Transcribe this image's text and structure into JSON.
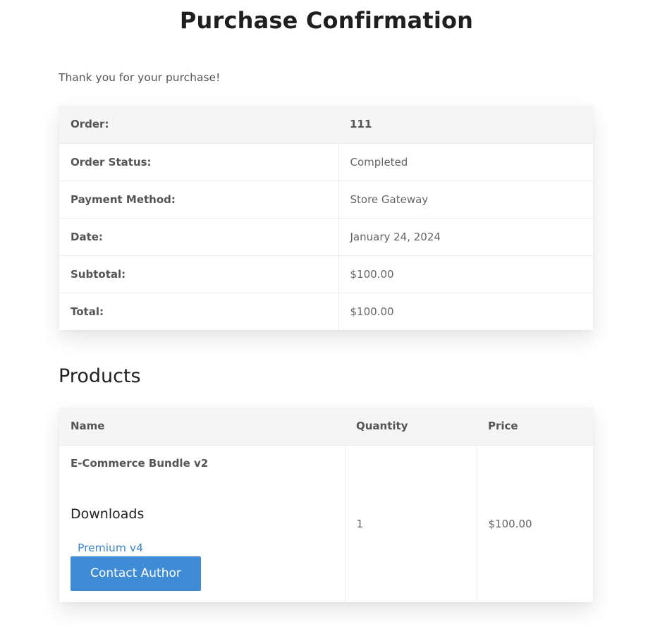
{
  "page": {
    "title": "Purchase Confirmation",
    "intro": "Thank you for your purchase!"
  },
  "order": {
    "rows": [
      {
        "label": "Order:",
        "value": "111"
      },
      {
        "label": "Order Status:",
        "value": "Completed"
      },
      {
        "label": "Payment Method:",
        "value": "Store Gateway"
      },
      {
        "label": "Date:",
        "value": "January 24, 2024"
      },
      {
        "label": "Subtotal:",
        "value": "$100.00"
      },
      {
        "label": "Total:",
        "value": "$100.00"
      }
    ]
  },
  "products": {
    "title": "Products",
    "headers": {
      "name": "Name",
      "quantity": "Quantity",
      "price": "Price"
    },
    "items": [
      {
        "name": "E-Commerce Bundle v2",
        "downloads_title": "Downloads",
        "download_link": "Premium v4",
        "contact_label": "Contact Author",
        "quantity": "1",
        "price": "$100.00"
      }
    ]
  },
  "colors": {
    "accent": "#3f8bd6",
    "link": "#3a85cf",
    "header_bg": "#f5f5f5"
  }
}
